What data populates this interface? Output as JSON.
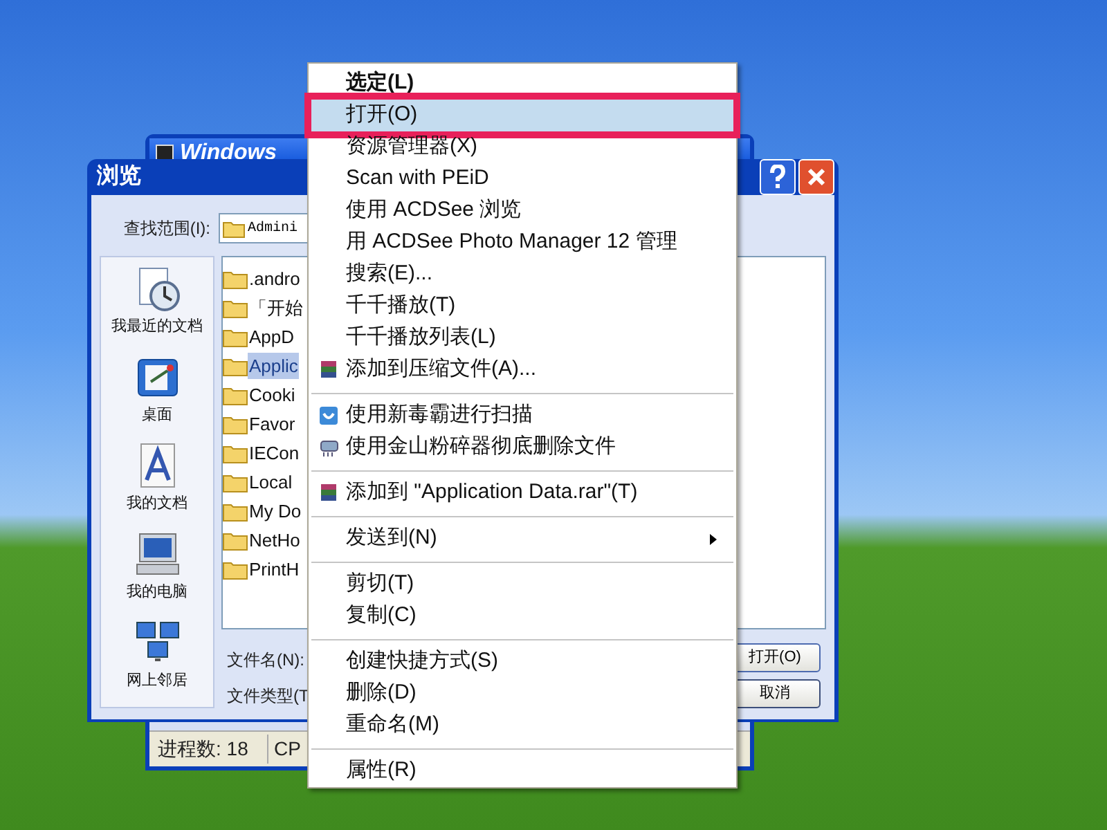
{
  "back_window": {
    "title": "Windows",
    "status_bar": [
      "进程数: 18",
      "CP"
    ]
  },
  "dialog": {
    "title": "浏览",
    "look_in_label": "查找范围(I):",
    "look_in_value": "Admini",
    "places": [
      {
        "label": "我最近的文档"
      },
      {
        "label": "桌面"
      },
      {
        "label": "我的文档"
      },
      {
        "label": "我的电脑"
      },
      {
        "label": "网上邻居"
      }
    ],
    "files": [
      {
        "name": ".andro",
        "selected": false
      },
      {
        "name": "「开始",
        "selected": false
      },
      {
        "name": "AppD",
        "selected": false
      },
      {
        "name": "Applic",
        "selected": true
      },
      {
        "name": "Cooki",
        "selected": false
      },
      {
        "name": "Favor",
        "selected": false
      },
      {
        "name": "IECon",
        "selected": false
      },
      {
        "name": "Local",
        "selected": false
      },
      {
        "name": "My Do",
        "selected": false
      },
      {
        "name": "NetHo",
        "selected": false
      },
      {
        "name": "PrintH",
        "selected": false
      }
    ],
    "file_name_label": "文件名(N):",
    "file_type_label": "文件类型(T",
    "buttons": [
      "打开(O)",
      "取消"
    ]
  },
  "context_menu": [
    {
      "kind": "item",
      "label": "选定(L)",
      "bold": true,
      "selected": false
    },
    {
      "kind": "item",
      "label": "打开(O)",
      "selected": true
    },
    {
      "kind": "item",
      "label": "资源管理器(X)",
      "selected": false
    },
    {
      "kind": "item",
      "label": "Scan with PEiD",
      "selected": false
    },
    {
      "kind": "item",
      "label": "使用 ACDSee 浏览",
      "selected": false
    },
    {
      "kind": "item",
      "label": "用 ACDSee Photo Manager 12 管理",
      "selected": false
    },
    {
      "kind": "item",
      "label": "搜索(E)...",
      "selected": false
    },
    {
      "kind": "item",
      "label": "千千播放(T)",
      "selected": false
    },
    {
      "kind": "item",
      "label": "千千播放列表(L)",
      "selected": false
    },
    {
      "kind": "archive",
      "label": "添加到压缩文件(A)...",
      "selected": false
    },
    {
      "kind": "separator"
    },
    {
      "kind": "antivirus",
      "label": "使用新毒霸进行扫描",
      "selected": false
    },
    {
      "kind": "shredder",
      "label": "使用金山粉碎器彻底删除文件",
      "selected": false
    },
    {
      "kind": "separator"
    },
    {
      "kind": "archive",
      "label": "添加到 \"Application Data.rar\"(T)",
      "selected": false
    },
    {
      "kind": "separator"
    },
    {
      "kind": "item",
      "label": "发送到(N)",
      "submenu": true,
      "selected": false
    },
    {
      "kind": "separator"
    },
    {
      "kind": "item",
      "label": "剪切(T)",
      "selected": false
    },
    {
      "kind": "item",
      "label": "复制(C)",
      "selected": false
    },
    {
      "kind": "separator"
    },
    {
      "kind": "item",
      "label": "创建快捷方式(S)",
      "selected": false
    },
    {
      "kind": "item",
      "label": "删除(D)",
      "selected": false
    },
    {
      "kind": "item",
      "label": "重命名(M)",
      "selected": false
    },
    {
      "kind": "separator"
    },
    {
      "kind": "item",
      "label": "属性(R)",
      "selected": false
    }
  ]
}
